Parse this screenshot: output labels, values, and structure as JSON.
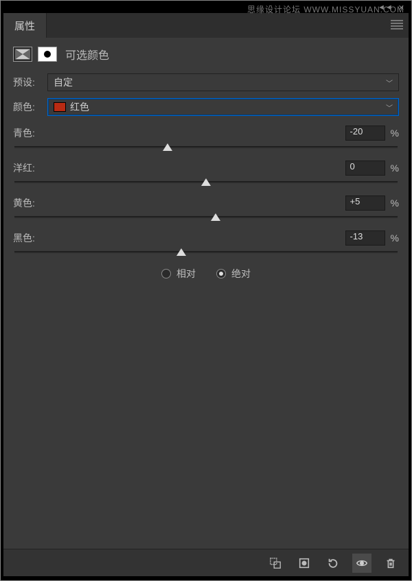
{
  "watermark": "思缘设计论坛 WWW.MISSYUAN.COM",
  "panel": {
    "tab_label": "属性",
    "title": "可选颜色",
    "preset_label": "预设:",
    "preset_value": "自定",
    "color_label": "颜色:",
    "color_value": "红色",
    "color_swatch": "#b92b13"
  },
  "sliders": [
    {
      "label": "青色:",
      "value": "-20",
      "percent": "%",
      "pos": 40
    },
    {
      "label": "洋红:",
      "value": "0",
      "percent": "%",
      "pos": 50
    },
    {
      "label": "黄色:",
      "value": "+5",
      "percent": "%",
      "pos": 52.5
    },
    {
      "label": "黑色:",
      "value": "-13",
      "percent": "%",
      "pos": 43.5
    }
  ],
  "method": {
    "relative_label": "相对",
    "absolute_label": "绝对",
    "selected": "absolute"
  }
}
